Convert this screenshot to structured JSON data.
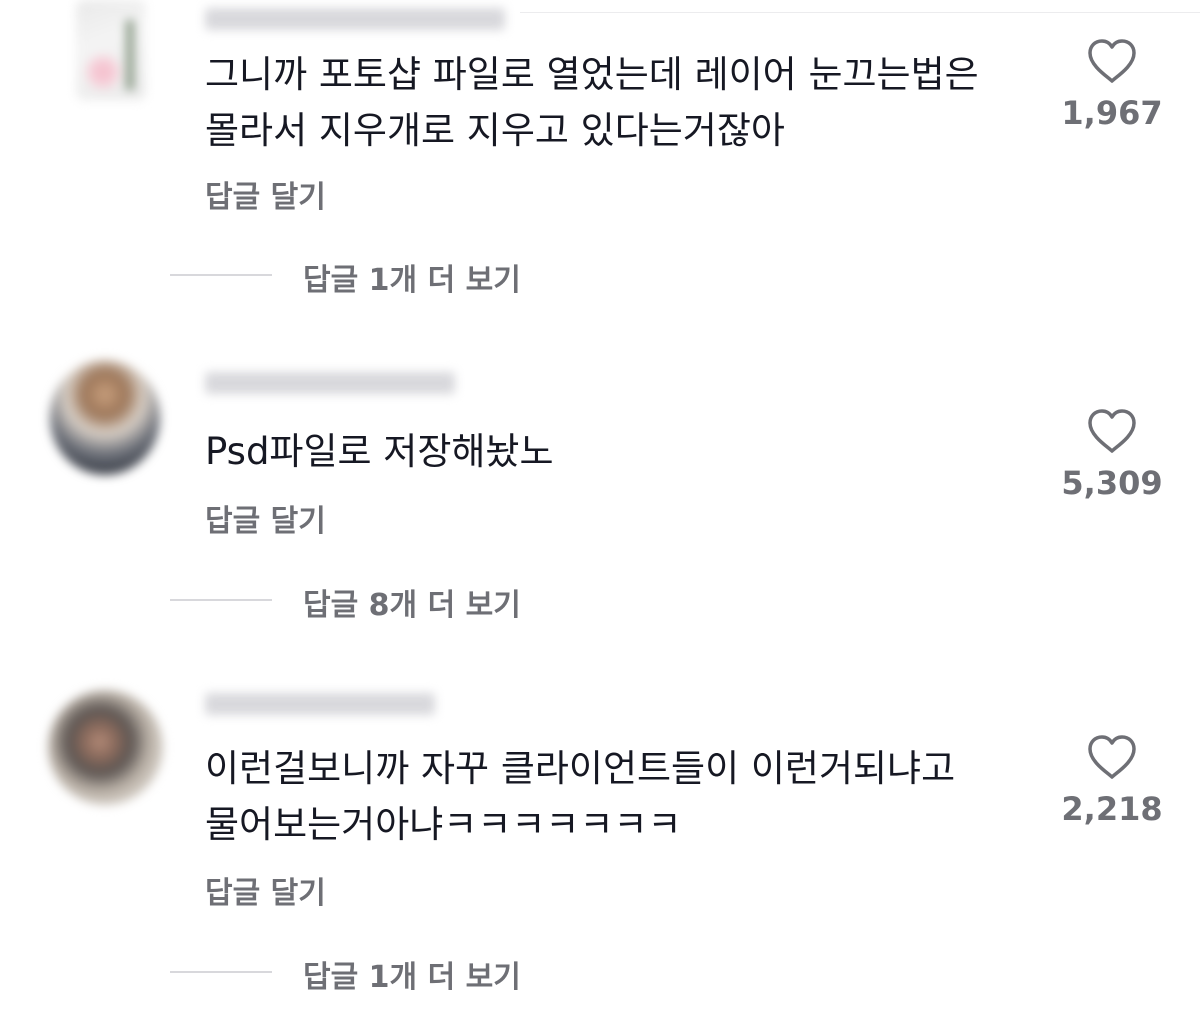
{
  "comments": [
    {
      "username": "",
      "text_lines": [
        "그니까 포토샵 파일로 열었는데 레이어 눈끄는법은",
        "몰라서 지우개로 지우고 있다는거잖아"
      ],
      "likes": "1,967",
      "reply_label": "답글 달기",
      "more_replies": "답글 1개 더 보기"
    },
    {
      "username": "",
      "text_lines": [
        "Psd파일로 저장해놨노"
      ],
      "likes": "5,309",
      "reply_label": "답글 달기",
      "more_replies": "답글 8개 더 보기"
    },
    {
      "username": "",
      "text_lines": [
        "이런걸보니까 자꾸 클라이언트들이 이런거되냐고",
        "물어보는거아냐ㅋㅋㅋㅋㅋㅋㅋ"
      ],
      "likes": "2,218",
      "reply_label": "답글 달기",
      "more_replies": "답글 1개 더 보기"
    }
  ],
  "icons": {
    "like": "heart-outline-icon"
  },
  "colors": {
    "text": "#161823",
    "secondary": "#6e6f75",
    "divider": "#d8d8dc"
  }
}
